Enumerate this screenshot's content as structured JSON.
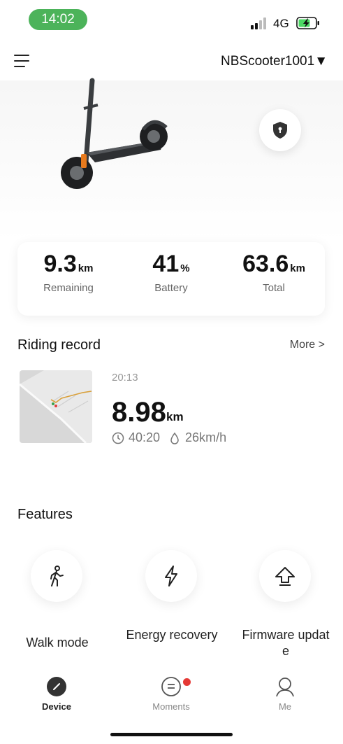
{
  "status_bar": {
    "time": "14:02",
    "network": "4G",
    "time_pill_color": "#4cb35a"
  },
  "header": {
    "device_name": "NBScooter1001▼"
  },
  "stats": [
    {
      "value": "9.3",
      "unit": "km",
      "label": "Remaining"
    },
    {
      "value": "41",
      "unit": "%",
      "label": "Battery"
    },
    {
      "value": "63.6",
      "unit": "km",
      "label": "Total"
    }
  ],
  "riding_record": {
    "title": "Riding record",
    "more": "More >",
    "time": "20:13",
    "distance": "8.98",
    "distance_unit": "km",
    "duration": "40:20",
    "avg_speed": "26km/h"
  },
  "features": {
    "title": "Features",
    "items": [
      {
        "label": "Walk mode",
        "icon": "walking-person-icon"
      },
      {
        "label": "Energy recovery",
        "icon": "lightning-bolt-icon"
      },
      {
        "label": "Firmware update",
        "icon": "upload-arrow-icon"
      }
    ]
  },
  "bottom_nav": {
    "items": [
      {
        "label": "Device",
        "icon": "device-icon",
        "active": true
      },
      {
        "label": "Moments",
        "icon": "chat-bubble-icon",
        "badge": true
      },
      {
        "label": "Me",
        "icon": "person-icon"
      }
    ],
    "active_color": "#222222",
    "inactive_color": "#888888",
    "badge_color": "#e53935"
  }
}
